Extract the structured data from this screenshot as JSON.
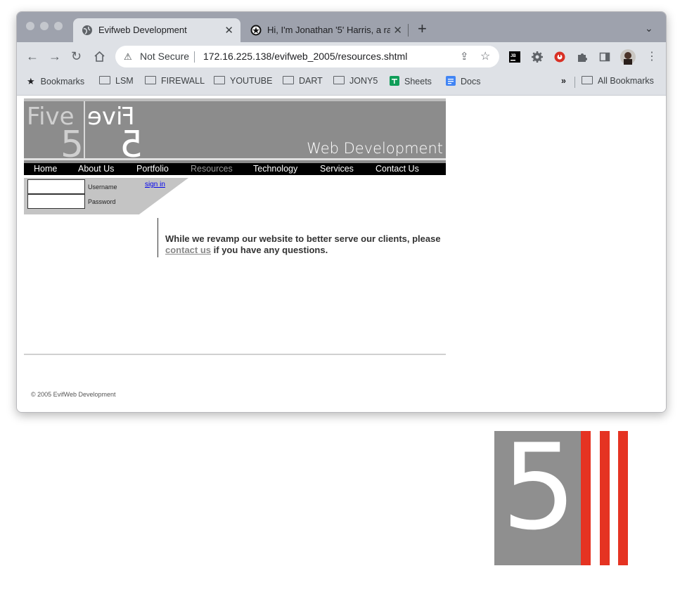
{
  "browser": {
    "tabs": [
      {
        "title": "Evifweb Development",
        "active": true
      },
      {
        "title": "Hi, I'm Jonathan '5' Harris, a ra",
        "active": false
      }
    ],
    "new_tab": "+",
    "security_label": "Not Secure",
    "url": "172.16.225.138/evifweb_2005/resources.shtml",
    "extensions": [
      "jetbrains-icon",
      "gear-extension-icon",
      "red-circle-extension-icon",
      "puzzle-icon",
      "sidepanel-icon",
      "profile-avatar"
    ],
    "bookmarks": [
      {
        "label": "Bookmarks",
        "icon": "star-icon"
      },
      {
        "label": "LSM",
        "icon": "folder-icon"
      },
      {
        "label": "FIREWALL",
        "icon": "folder-icon"
      },
      {
        "label": "YOUTUBE",
        "icon": "folder-icon"
      },
      {
        "label": "DART",
        "icon": "folder-icon"
      },
      {
        "label": "JONY5",
        "icon": "folder-icon"
      },
      {
        "label": "Sheets",
        "icon": "sheets-icon"
      },
      {
        "label": "Docs",
        "icon": "docs-icon"
      }
    ],
    "bookmarks_overflow": "»",
    "all_bookmarks": "All Bookmarks"
  },
  "site": {
    "logo_word": "Five",
    "logo_number": "5",
    "tagline": "Web Development",
    "menu": [
      {
        "label": "Home",
        "active": false
      },
      {
        "label": "About Us",
        "active": false
      },
      {
        "label": "Portfolio",
        "active": false
      },
      {
        "label": "Resources",
        "active": true
      },
      {
        "label": "Technology",
        "active": false
      },
      {
        "label": "Services",
        "active": false
      },
      {
        "label": "Contact Us",
        "active": false
      }
    ],
    "login": {
      "username_label": "Username",
      "password_label": "Password",
      "username_value": "",
      "password_value": "",
      "sign_in": "sign in"
    },
    "message_before": "While we revamp our website to better serve our clients, please",
    "message_link": "contact us",
    "message_after": "if you have any questions.",
    "copyright": "© 2005 EvifWeb Development"
  },
  "big_logo": {
    "number": "5",
    "colors": {
      "box": "#8f8f8f",
      "bars": "#e53322"
    }
  }
}
